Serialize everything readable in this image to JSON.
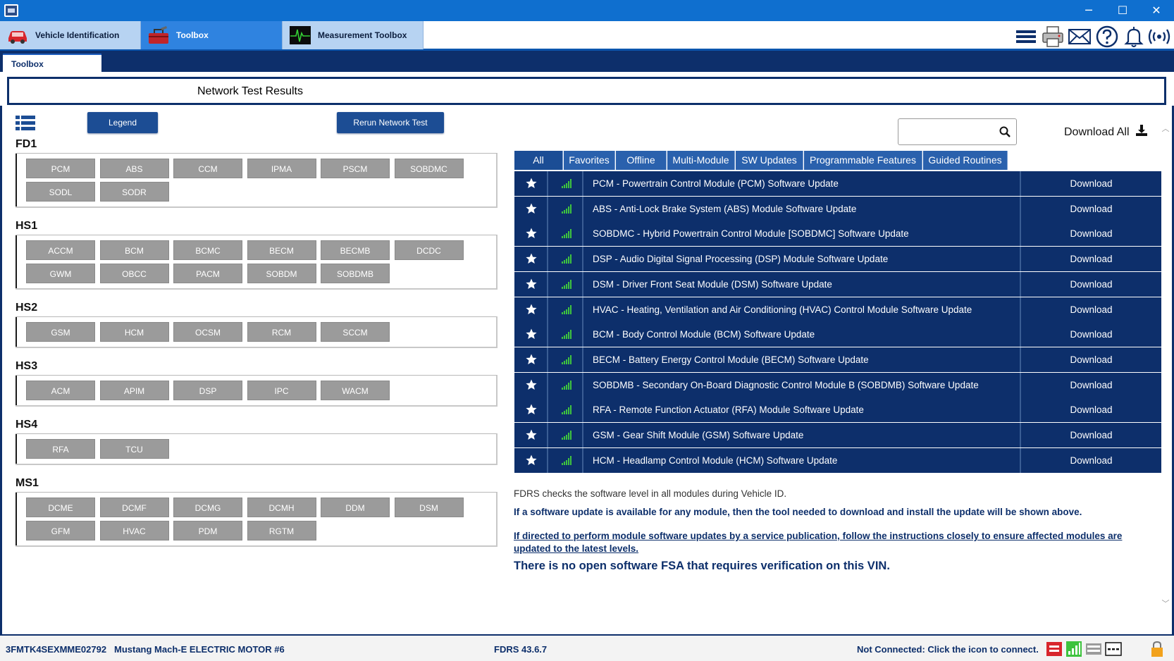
{
  "window": {
    "minimize_glyph": "─",
    "maximize_glyph": "☐",
    "close_glyph": "✕"
  },
  "top_tabs": [
    {
      "label": "Vehicle Identification",
      "icon": "car-icon"
    },
    {
      "label": "Toolbox",
      "icon": "toolbox-icon"
    },
    {
      "label": "Measurement Toolbox",
      "icon": "oscilloscope-icon"
    }
  ],
  "right_icons": [
    "menu-icon",
    "printer-icon",
    "mail-icon",
    "help-icon",
    "bell-icon",
    "wireless-icon"
  ],
  "sub_tab": "Toolbox",
  "page_title": "Network Test Results",
  "buttons": {
    "legend": "Legend",
    "rerun": "Rerun Network Test"
  },
  "networks": [
    {
      "name": "FD1",
      "modules": [
        "PCM",
        "ABS",
        "CCM",
        "IPMA",
        "PSCM",
        "SOBDMC",
        "SODL",
        "SODR"
      ]
    },
    {
      "name": "HS1",
      "modules": [
        "ACCM",
        "BCM",
        "BCMC",
        "BECM",
        "BECMB",
        "DCDC",
        "GWM",
        "OBCC",
        "PACM",
        "SOBDM",
        "SOBDMB"
      ]
    },
    {
      "name": "HS2",
      "modules": [
        "GSM",
        "HCM",
        "OCSM",
        "RCM",
        "SCCM"
      ]
    },
    {
      "name": "HS3",
      "modules": [
        "ACM",
        "APIM",
        "DSP",
        "IPC",
        "WACM"
      ]
    },
    {
      "name": "HS4",
      "modules": [
        "RFA",
        "TCU"
      ]
    },
    {
      "name": "MS1",
      "modules": [
        "DCME",
        "DCMF",
        "DCMG",
        "DCMH",
        "DDM",
        "DSM",
        "GFM",
        "HVAC",
        "PDM",
        "RGTM"
      ]
    }
  ],
  "search": {
    "placeholder": "",
    "value": ""
  },
  "download_all": "Download All",
  "filter_tabs": [
    "All",
    "Favorites",
    "Offline",
    "Multi-Module",
    "SW Updates",
    "Programmable Features",
    "Guided Routines"
  ],
  "active_filter": "All",
  "updates": [
    {
      "text": "PCM - Powertrain Control Module (PCM) Software Update",
      "action": "Download"
    },
    {
      "text": "ABS - Anti-Lock Brake System (ABS) Module Software Update",
      "action": "Download"
    },
    {
      "text": "SOBDMC - Hybrid Powertrain Control Module [SOBDMC] Software Update",
      "action": "Download"
    },
    {
      "text": "DSP - Audio Digital Signal Processing (DSP) Module Software Update",
      "action": "Download"
    },
    {
      "text": "DSM - Driver Front Seat Module (DSM) Software Update",
      "action": "Download"
    },
    {
      "text": "HVAC - Heating, Ventilation and Air Conditioning (HVAC) Control Module Software Update",
      "action": "Download"
    },
    {
      "text": "BCM - Body Control Module (BCM) Software Update",
      "action": "Download"
    },
    {
      "text": "BECM - Battery Energy Control Module (BECM) Software Update",
      "action": "Download"
    },
    {
      "text": "SOBDMB - Secondary On-Board Diagnostic Control Module B (SOBDMB) Software Update",
      "action": "Download"
    },
    {
      "text": "RFA - Remote Function Actuator (RFA) Module Software Update",
      "action": "Download"
    },
    {
      "text": "GSM - Gear Shift Module (GSM) Software Update",
      "action": "Download"
    },
    {
      "text": "HCM - Headlamp Control Module (HCM) Software Update",
      "action": "Download"
    }
  ],
  "info": {
    "line1": "FDRS checks the software level in all modules during Vehicle ID.",
    "line2": "If a software update is available for any module, then the tool needed to download and install the update will be shown above.",
    "line3": "If directed to perform module software updates by a service publication, follow the instructions closely to ensure affected modules are updated to the latest levels.",
    "line4": "There is no open software FSA that requires verification on this VIN."
  },
  "status": {
    "vin": "3FMTK4SEXMME02792",
    "vehicle": "Mustang Mach-E ELECTRIC MOTOR #6",
    "version": "FDRS 43.6.7",
    "connection": "Not Connected: Click the icon to connect."
  },
  "colors": {
    "navy": "#0d2f6b",
    "title_blue": "#0f6fcf",
    "module_gray": "#9b9b9b",
    "signal_green": "#3ec33e"
  }
}
